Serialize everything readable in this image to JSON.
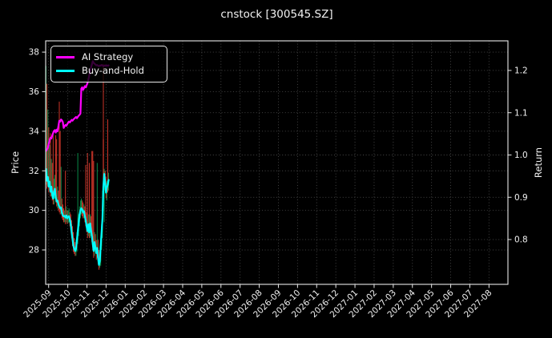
{
  "chart_data": {
    "type": "candlestick+line",
    "title": "cnstock [300545.SZ]",
    "ylabel_left": "Price",
    "ylabel_right": "Return",
    "x_tick_labels": [
      "2025-09",
      "2025-10",
      "2025-11",
      "2025-12",
      "2026-01",
      "2026-02",
      "2026-03",
      "2026-04",
      "2026-05",
      "2026-06",
      "2026-07",
      "2026-08",
      "2026-09",
      "2026-10",
      "2026-11",
      "2026-12",
      "2027-01",
      "2027-02",
      "2027-03",
      "2027-04",
      "2027-05",
      "2027-06",
      "2027-07",
      "2027-08"
    ],
    "price_ticks": [
      28,
      30,
      32,
      34,
      36,
      38
    ],
    "return_ticks": [
      0.8,
      0.9,
      1.0,
      1.1,
      1.2
    ],
    "ylim_price": [
      26.26,
      38.57
    ],
    "ylim_return": [
      0.694,
      1.27
    ],
    "xlim_months": [
      -0.155,
      23.99
    ],
    "grid": {
      "show": true,
      "style": "dotted"
    },
    "legend": {
      "position": "upper-left",
      "entries": [
        {
          "label": "AI Strategy",
          "color": "#ff00ff"
        },
        {
          "label": "Buy-and-Hold",
          "color": "#00ffff"
        }
      ]
    },
    "colors": {
      "background": "#000000",
      "text": "#f2f2f2",
      "grid": "#4a4a4a",
      "spine": "#e8e8e8",
      "candle_up": "#0a9950",
      "candle_down": "#e33b2e",
      "ai_strategy": "#ff00ff",
      "buy_and_hold": "#00ffff"
    },
    "candles": {
      "x_start_month": -0.134,
      "x_step_month": 0.04603,
      "ohlc": [
        [
          31.6,
          37.3,
          31.3,
          32.1
        ],
        [
          32.1,
          36.4,
          31.1,
          31.5
        ],
        [
          31.5,
          35.1,
          31.2,
          31.7
        ],
        [
          31.7,
          34.2,
          30.9,
          31.2
        ],
        [
          31.2,
          33.3,
          31.0,
          31.45
        ],
        [
          31.45,
          33.9,
          30.7,
          30.95
        ],
        [
          30.95,
          32.6,
          30.7,
          31.2
        ],
        [
          31.2,
          32.4,
          30.5,
          30.8
        ],
        [
          30.8,
          34.0,
          30.3,
          30.6
        ],
        [
          30.6,
          31.6,
          30.3,
          30.95
        ],
        [
          30.95,
          31.8,
          30.6,
          31.1
        ],
        [
          31.1,
          33.8,
          30.4,
          30.65
        ],
        [
          30.65,
          33.6,
          30.2,
          30.45
        ],
        [
          30.45,
          31.2,
          30.1,
          30.5
        ],
        [
          30.5,
          31.0,
          30.0,
          30.3
        ],
        [
          30.3,
          35.5,
          29.9,
          30.2
        ],
        [
          30.2,
          34.0,
          29.8,
          30.1
        ],
        [
          30.1,
          32.2,
          29.8,
          30.15
        ],
        [
          30.15,
          30.6,
          29.6,
          29.9
        ],
        [
          29.9,
          30.3,
          29.5,
          29.75
        ],
        [
          29.75,
          30.1,
          29.4,
          29.7
        ],
        [
          29.7,
          30.0,
          29.4,
          29.72
        ],
        [
          29.72,
          32.0,
          29.3,
          29.65
        ],
        [
          29.65,
          30.2,
          29.4,
          29.75
        ],
        [
          29.75,
          30.0,
          29.3,
          29.6
        ],
        [
          29.6,
          30.0,
          29.35,
          29.68
        ],
        [
          29.68,
          30.1,
          29.4,
          29.7
        ],
        [
          29.7,
          29.9,
          29.2,
          29.55
        ],
        [
          29.55,
          29.8,
          29.0,
          29.3
        ],
        [
          29.3,
          29.5,
          28.6,
          28.9
        ],
        [
          28.9,
          29.2,
          28.2,
          28.55
        ],
        [
          28.55,
          28.9,
          27.9,
          28.2
        ],
        [
          28.2,
          28.6,
          27.8,
          28.05
        ],
        [
          28.05,
          28.4,
          27.7,
          27.95
        ],
        [
          27.95,
          28.5,
          27.7,
          28.05
        ],
        [
          28.05,
          28.9,
          27.9,
          28.5
        ],
        [
          28.5,
          32.9,
          28.3,
          28.95
        ],
        [
          28.95,
          29.8,
          28.7,
          29.4
        ],
        [
          29.4,
          30.2,
          29.2,
          29.8
        ],
        [
          29.8,
          30.5,
          29.6,
          30.0
        ],
        [
          30.0,
          30.6,
          29.8,
          30.1
        ],
        [
          30.1,
          30.5,
          29.7,
          30.05
        ],
        [
          30.05,
          30.4,
          29.6,
          29.9
        ],
        [
          29.9,
          30.3,
          29.6,
          29.95
        ],
        [
          29.95,
          30.2,
          29.4,
          29.7
        ],
        [
          29.7,
          32.3,
          29.2,
          29.5
        ],
        [
          29.5,
          29.9,
          28.9,
          29.2
        ],
        [
          29.2,
          32.9,
          28.6,
          28.95
        ],
        [
          28.95,
          29.8,
          28.7,
          29.3
        ],
        [
          29.3,
          32.4,
          28.6,
          28.9
        ],
        [
          28.9,
          29.8,
          28.6,
          29.35
        ],
        [
          29.35,
          29.7,
          28.7,
          29.0
        ],
        [
          29.0,
          33.0,
          28.4,
          28.7
        ],
        [
          28.7,
          33.0,
          28.0,
          28.3
        ],
        [
          28.3,
          32.5,
          27.6,
          27.95
        ],
        [
          27.95,
          28.9,
          27.7,
          28.4
        ],
        [
          28.4,
          28.8,
          27.9,
          28.15
        ],
        [
          28.15,
          28.5,
          27.5,
          27.85
        ],
        [
          27.85,
          32.4,
          27.6,
          28.1
        ],
        [
          28.1,
          28.5,
          27.3,
          27.6
        ],
        [
          27.6,
          28.0,
          27.0,
          27.25
        ],
        [
          27.25,
          27.9,
          27.1,
          27.45
        ],
        [
          27.45,
          28.6,
          27.2,
          28.2
        ],
        [
          28.2,
          29.3,
          28.0,
          28.9
        ],
        [
          28.9,
          31.0,
          28.6,
          29.6
        ],
        [
          33.6,
          37.4,
          30.2,
          31.2
        ],
        [
          31.2,
          32.1,
          29.4,
          31.85
        ],
        [
          31.85,
          32.0,
          31.0,
          31.4
        ],
        [
          31.4,
          31.7,
          30.6,
          30.9
        ],
        [
          30.9,
          31.5,
          30.5,
          31.15
        ],
        [
          31.4,
          34.6,
          30.9,
          31.3
        ],
        [
          31.3,
          31.9,
          31.0,
          31.55
        ]
      ]
    },
    "series": [
      {
        "name": "AI Strategy",
        "axis": "return",
        "color": "#ff00ff",
        "values": [
          1.01,
          1.013,
          1.017,
          1.026,
          1.035,
          1.041,
          1.039,
          1.046,
          1.052,
          1.057,
          1.059,
          1.053,
          1.06,
          1.056,
          1.068,
          1.081,
          1.079,
          1.084,
          1.082,
          1.078,
          1.064,
          1.068,
          1.071,
          1.069,
          1.073,
          1.076,
          1.079,
          1.077,
          1.08,
          1.083,
          1.081,
          1.084,
          1.086,
          1.088,
          1.09,
          1.087,
          1.09,
          1.093,
          1.095,
          1.098,
          1.157,
          1.16,
          1.154,
          1.158,
          1.163,
          1.16,
          1.165,
          1.17,
          1.178,
          1.188,
          1.198,
          1.207,
          1.214,
          1.222,
          1.218,
          1.216,
          1.214,
          1.212,
          1.213,
          1.211,
          1.21,
          1.212,
          1.211,
          1.213,
          1.212,
          1.21,
          1.211,
          1.212,
          1.211,
          1.212,
          1.211,
          1.212
        ]
      },
      {
        "name": "Buy-and-Hold",
        "axis": "return",
        "color": "#00ffff",
        "values": [
          0.967,
          0.939,
          0.948,
          0.925,
          0.937,
          0.913,
          0.925,
          0.906,
          0.897,
          0.913,
          0.92,
          0.899,
          0.89,
          0.892,
          0.883,
          0.878,
          0.874,
          0.876,
          0.864,
          0.857,
          0.855,
          0.856,
          0.852,
          0.857,
          0.85,
          0.854,
          0.855,
          0.848,
          0.836,
          0.817,
          0.801,
          0.785,
          0.778,
          0.773,
          0.778,
          0.799,
          0.82,
          0.841,
          0.859,
          0.869,
          0.874,
          0.871,
          0.864,
          0.867,
          0.855,
          0.845,
          0.831,
          0.82,
          0.836,
          0.817,
          0.838,
          0.822,
          0.808,
          0.789,
          0.773,
          0.794,
          0.782,
          0.768,
          0.78,
          0.756,
          0.74,
          0.749,
          0.785,
          0.817,
          0.85,
          0.925,
          0.955,
          0.934,
          0.911,
          0.923,
          0.93,
          0.941
        ]
      }
    ]
  }
}
